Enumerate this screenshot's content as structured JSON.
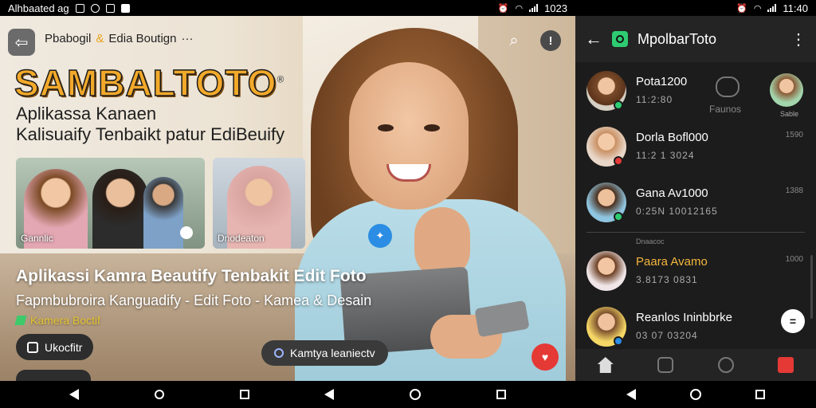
{
  "status_left": {
    "text": "Alhbaated ag",
    "time": "1023"
  },
  "status_right": {
    "time": "11:40"
  },
  "left_app": {
    "top_title": "Pbabogil",
    "top_amp": "&",
    "top_title2": "Edia Boutign",
    "top_more": "···",
    "brand": "SAMBALTOTO",
    "brand_mark": "®",
    "subtitle1": "Aplikassa Kanaen",
    "subtitle2": "Kalisuaify Tenbaikt patur EdiBeuify",
    "thumb1_label": "Gannlic",
    "thumb2_label": "Dnodeaton",
    "headline": "Aplikassi Kamra Beautify Tenbakit Edit Foto",
    "tagline": "Fapmbubroira Kanguadify - Edit Foto - Kamea & Desain",
    "source": "Kamera Boctif",
    "pill_label": "Ukocfitr",
    "center_pill": "Kamtya leaniectv"
  },
  "right_app": {
    "title": "MpolbarToto",
    "chats": [
      {
        "name": "Pota1200",
        "meta": "11:2:80",
        "time": "",
        "dot": "#2ecc71"
      },
      {
        "name": "Dorla Bofl000",
        "meta": "11:2 1 3024",
        "time": "1590",
        "dot": "#e53935"
      },
      {
        "name": "Gana Av1000",
        "meta": "0:25N 10012165",
        "time": "1388",
        "dot": "#2ecc71"
      },
      {
        "name": "Paara Avamo",
        "meta": "3.8173 0831",
        "time": "1000",
        "dot": ""
      },
      {
        "name": "Reanlos Ininbbrke",
        "meta": "03 07 03204",
        "time": "",
        "dot": "#2b8de3"
      }
    ],
    "chat_icon_label": "Faunos",
    "thumb_label": "Sable",
    "section_label": "Dnaacoc"
  }
}
